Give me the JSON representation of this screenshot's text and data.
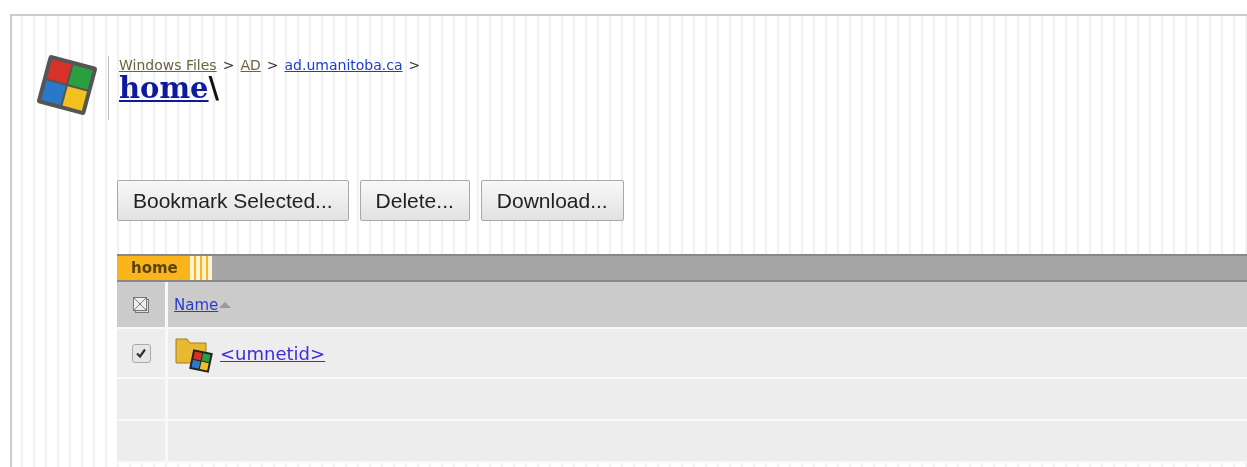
{
  "breadcrumb": [
    {
      "label": "Windows Files",
      "visited": true
    },
    {
      "label": "AD",
      "visited": true
    },
    {
      "label": "ad.umanitoba.ca",
      "visited": false
    }
  ],
  "separator": ">",
  "title": {
    "link": "home",
    "suffix": "\\"
  },
  "buttons": [
    "Bookmark Selected...",
    "Delete...",
    "Download..."
  ],
  "panel": {
    "tab": "home"
  },
  "table": {
    "columns": [
      {
        "label": "Name",
        "sorted": true
      }
    ],
    "rows": [
      {
        "name": "<umnetid>",
        "checked": true
      }
    ]
  }
}
